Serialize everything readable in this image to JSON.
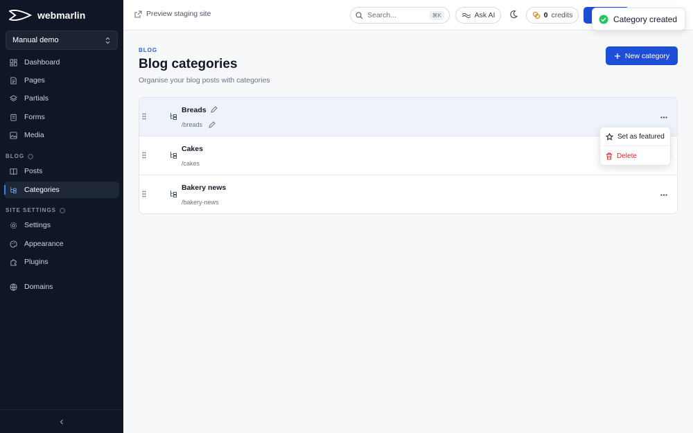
{
  "brand": {
    "name": "webmarlin"
  },
  "project": {
    "name": "Manual demo"
  },
  "sidebar": {
    "main_items": [
      {
        "label": "Dashboard",
        "icon": "dashboard-icon"
      },
      {
        "label": "Pages",
        "icon": "page-icon"
      },
      {
        "label": "Partials",
        "icon": "layers-icon"
      },
      {
        "label": "Forms",
        "icon": "form-icon"
      },
      {
        "label": "Media",
        "icon": "image-icon"
      }
    ],
    "blog_section": "BLOG",
    "blog_items": [
      {
        "label": "Posts",
        "icon": "book-icon"
      },
      {
        "label": "Categories",
        "icon": "category-tree-icon",
        "active": true
      }
    ],
    "site_section": "SITE SETTINGS",
    "site_items": [
      {
        "label": "Settings",
        "icon": "gear-icon"
      },
      {
        "label": "Appearance",
        "icon": "palette-icon"
      },
      {
        "label": "Plugins",
        "icon": "puzzle-icon"
      }
    ],
    "domains": {
      "label": "Domains",
      "icon": "globe-icon"
    }
  },
  "topbar": {
    "preview_label": "Preview staging site",
    "search_placeholder": "Search...",
    "search_shortcut": "⌘K",
    "ask_ai_label": "Ask AI",
    "credits_count": "0",
    "credits_label": "credits"
  },
  "toast": {
    "message": "Category created",
    "color": "#22c55e"
  },
  "page": {
    "eyebrow": "BLOG",
    "title": "Blog categories",
    "subtitle": "Organise your blog posts with categories",
    "new_button_label": "New category"
  },
  "categories": [
    {
      "name": "Breads",
      "slug": "/breads"
    },
    {
      "name": "Cakes",
      "slug": "/cakes"
    },
    {
      "name": "Bakery news",
      "slug": "/bakery-news"
    }
  ],
  "row_menu": {
    "featured_label": "Set as featured",
    "delete_label": "Delete"
  },
  "colors": {
    "accent": "#1d4ed8",
    "sidebar_bg": "#0f1626",
    "danger": "#dc2626"
  }
}
